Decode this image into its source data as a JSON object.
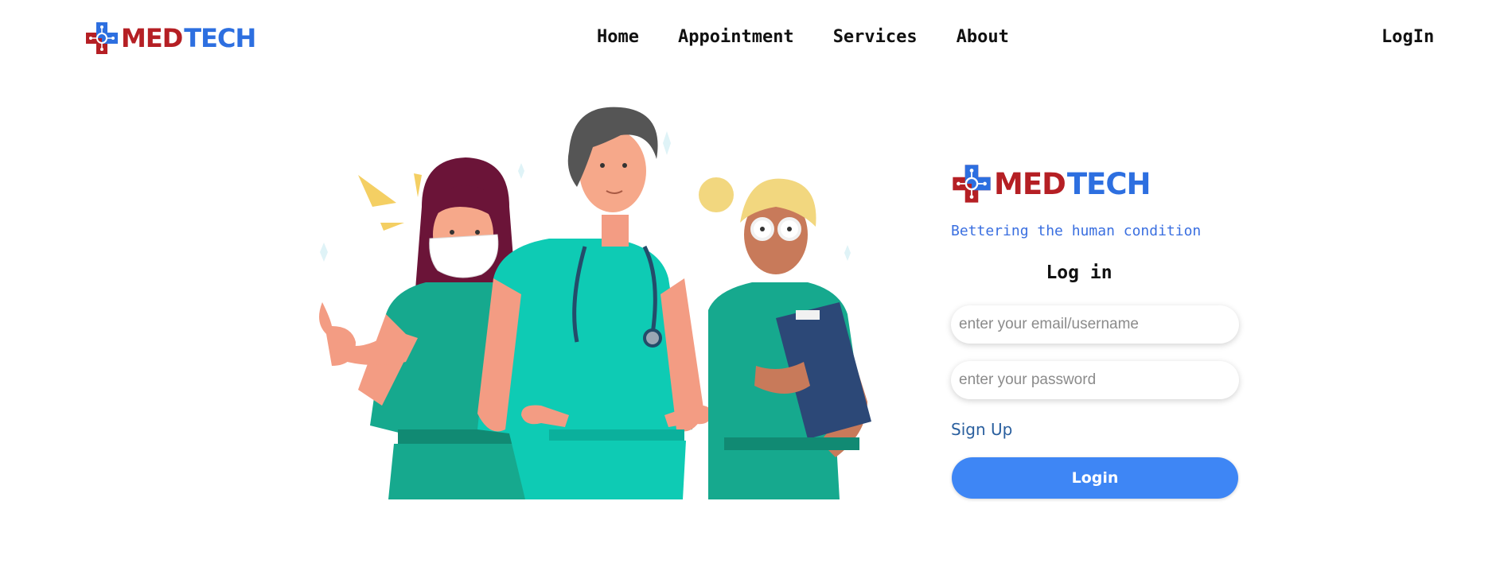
{
  "brand": {
    "part1": "MED",
    "part2": "TECH",
    "red": "#b51f24",
    "blue": "#2d6fe0"
  },
  "nav": {
    "links": [
      "Home",
      "Appointment",
      "Services",
      "About"
    ],
    "login": "LogIn"
  },
  "hero": {
    "image": "three-medical-staff-illustration"
  },
  "form": {
    "tagline": "Bettering the human condition",
    "title": "Log in",
    "email_placeholder": "enter your email/username",
    "password_placeholder": "enter your password",
    "signup": "Sign Up",
    "submit": "Login",
    "accent": "#3e86f5"
  }
}
